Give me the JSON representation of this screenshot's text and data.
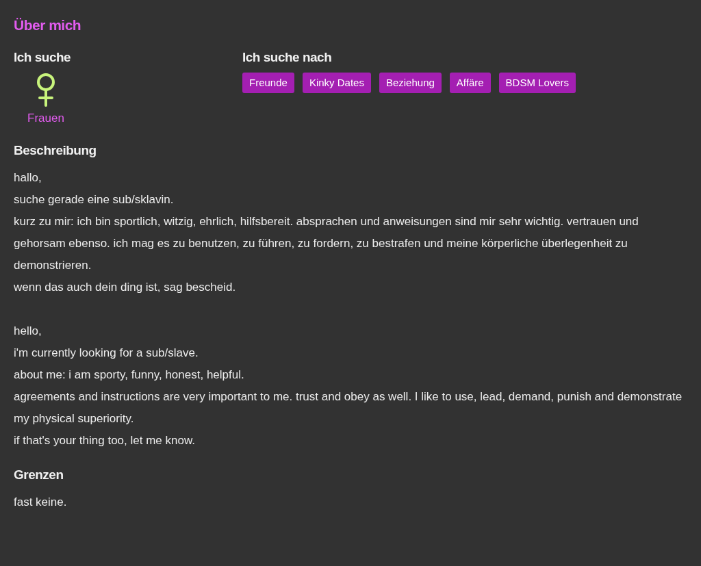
{
  "title": "Über mich",
  "seeking": {
    "heading": "Ich suche",
    "label": "Frauen"
  },
  "looking_for": {
    "heading": "Ich suche nach",
    "tags": [
      "Freunde",
      "Kinky Dates",
      "Beziehung",
      "Affäre",
      "BDSM Lovers"
    ]
  },
  "description": {
    "heading": "Beschreibung",
    "paragraphs": [
      [
        "hallo,",
        "suche gerade eine sub/sklavin.",
        "kurz zu mir: ich bin sportlich, witzig, ehrlich, hilfsbereit. absprachen und anweisungen sind mir sehr wichtig. vertrauen und gehorsam ebenso. ich mag es zu benutzen, zu führen, zu fordern, zu bestrafen und meine körperliche überlegenheit zu demonstrieren.",
        "wenn das auch dein ding ist, sag bescheid."
      ],
      [
        "hello,",
        "i'm currently looking for a sub/slave.",
        "about me: i am sporty, funny, honest, helpful.",
        "agreements and instructions are very important to me. trust and obey as well. I like to use, lead, demand, punish and demonstrate my physical superiority.",
        "if that's your thing too, let me know."
      ]
    ]
  },
  "limits": {
    "heading": "Grenzen",
    "text": "fast keine."
  }
}
